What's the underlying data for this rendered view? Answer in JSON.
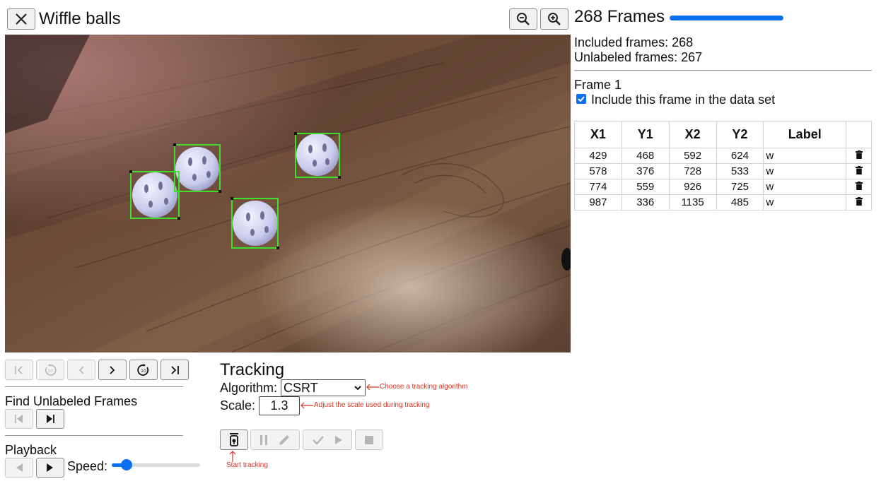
{
  "header": {
    "title": "Wiffle balls",
    "icons": {
      "close": "close-icon",
      "zoom_out": "zoom-out-icon",
      "zoom_in": "zoom-in-icon"
    }
  },
  "frames": {
    "title": "268 Frames",
    "progress_fraction": 1.0,
    "included_text": "Included frames: 268",
    "unlabeled_text": "Unlabeled frames: 267",
    "current_frame_label": "Frame 1",
    "include_checkbox_label": "Include this frame in the data set",
    "include_checked": true
  },
  "table": {
    "headers": [
      "X1",
      "Y1",
      "X2",
      "Y2",
      "Label",
      ""
    ],
    "rows": [
      {
        "x1": "429",
        "y1": "468",
        "x2": "592",
        "y2": "624",
        "label": "w"
      },
      {
        "x1": "578",
        "y1": "376",
        "x2": "728",
        "y2": "533",
        "label": "w"
      },
      {
        "x1": "774",
        "y1": "559",
        "x2": "926",
        "y2": "725",
        "label": "w"
      },
      {
        "x1": "987",
        "y1": "336",
        "x2": "1135",
        "y2": "485",
        "label": "w"
      }
    ],
    "delete_icon": "trash-icon"
  },
  "navigation": {
    "icons": [
      "first-frame-icon",
      "back-10-icon",
      "previous-frame-icon",
      "next-frame-icon",
      "forward-10-icon",
      "last-frame-icon"
    ]
  },
  "find_unlabeled": {
    "title": "Find Unlabeled Frames",
    "icons": [
      "previous-unlabeled-icon",
      "next-unlabeled-icon"
    ]
  },
  "playback": {
    "title": "Playback",
    "speed_label": "Speed:",
    "speed_fraction": 0.17
  },
  "tracking": {
    "title": "Tracking",
    "algorithm_label": "Algorithm:",
    "algorithm_value": "CSRT",
    "scale_label": "Scale:",
    "scale_value": "1.3",
    "annotations": {
      "algorithm": "Choose a tracking algorithm",
      "scale": "Adjust the scale used during tracking",
      "start": "Start tracking"
    }
  },
  "colors": {
    "accent": "#0b6ff0",
    "annotation": "#d9331f",
    "bbox": "#3de02b"
  }
}
